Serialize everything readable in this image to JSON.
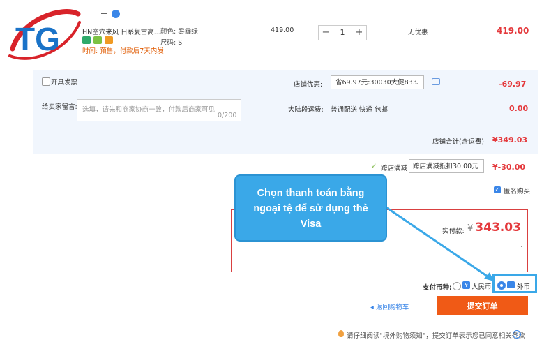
{
  "product": {
    "title": "HN空穴来风 日系复古高...",
    "attrs": [
      "颜色: 雾霾绿",
      "尺码: S"
    ],
    "note": "时间: 预售，付款后7天内发",
    "price": "419.00",
    "qty": "1",
    "discount": "无优惠",
    "total": "419.00"
  },
  "invoice": {
    "label": "开具发票"
  },
  "store_discount": {
    "label": "店铺优惠:",
    "selected": "省69.97元:30030大促833",
    "amount": "-69.97"
  },
  "message": {
    "label": "给卖家留言:",
    "placeholder": "选填，请先和商家协商一致，付款后商家可见",
    "count": "0/200"
  },
  "shipping": {
    "label": "大陆段运费:",
    "value": "普通配送 快递 包邮",
    "amount": "0.00"
  },
  "subtotal": {
    "label": "店铺合计(含运费)",
    "value": "¥349.03"
  },
  "cross_store": {
    "label": "跨店满减",
    "selected": "跨店满减抵扣30.00元",
    "amount": "¥-30.00"
  },
  "anonymous": {
    "label": "匿名购买"
  },
  "paid": {
    "label": "实付款:",
    "currency": "¥",
    "amount": "343.03"
  },
  "currency": {
    "label": "支付币种:",
    "rmb_icon_text": "¥",
    "rmb": "人民币",
    "foreign": "外币",
    "selected": "foreign"
  },
  "actions": {
    "back": "返回购物车",
    "submit": "提交订单"
  },
  "notice": "请仔细阅读\"境外购物须知\"，提交订单表示您已同意相关条款",
  "callout": {
    "lines": [
      "Chọn thanh toán bằng",
      "ngoại tệ để sử dụng thẻ",
      "Visa"
    ]
  },
  "logo": {
    "text": "TG"
  },
  "colors": {
    "accent": "#e4393c",
    "blue": "#3a86e8",
    "callout": "#3aa8e8",
    "submit": "#f05a16"
  }
}
